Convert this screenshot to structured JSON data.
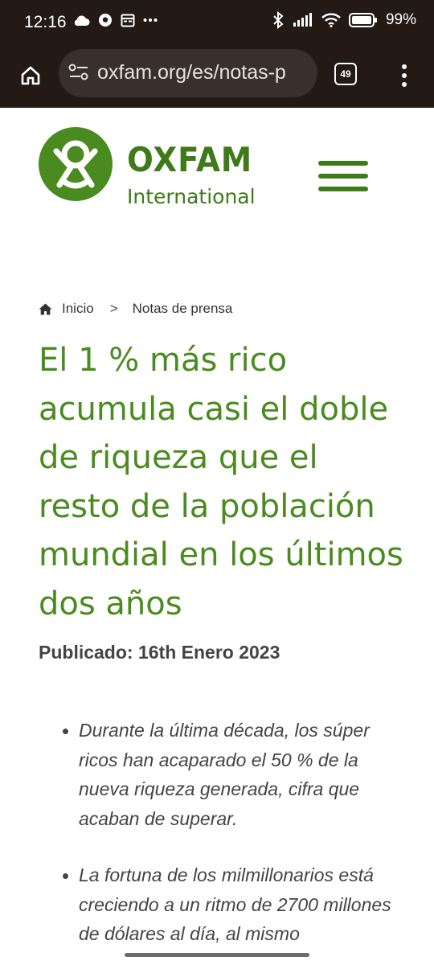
{
  "status_bar": {
    "time": "12:16",
    "battery": "99%",
    "left_icons": [
      "cloud-icon",
      "soccer-icon",
      "calendar-icon",
      "more-icon"
    ],
    "right_icons": [
      "bluetooth-icon",
      "signal-icon",
      "wifi-icon",
      "battery-icon"
    ]
  },
  "browser": {
    "url": "oxfam.org/es/notas-p",
    "tab_count": "49"
  },
  "site": {
    "logo_name": "OXFAM",
    "logo_sub": "International",
    "accent_color": "#4a8b1f"
  },
  "breadcrumb": {
    "home": "Inicio",
    "separator": ">",
    "current": "Notas de prensa"
  },
  "article": {
    "title": "El 1 % más rico acumula casi el doble de riqueza que el resto de la población mundial en los últimos dos años",
    "published": "Publicado: 16th Enero 2023",
    "bullets": [
      "Durante la última década, los súper ricos han acaparado el 50 % de la nueva riqueza generada, cifra que acaban de superar.",
      "La fortuna de los milmillonarios está creciendo a un ritmo de 2700 millones de dólares al día, al mismo"
    ]
  }
}
